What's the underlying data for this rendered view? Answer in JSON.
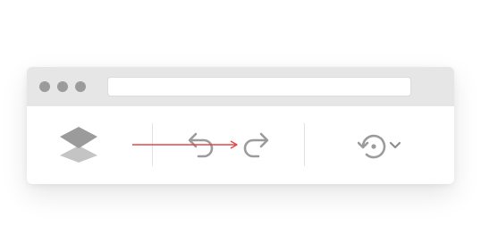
{
  "window": {
    "traffic_lights": [
      "window-dot-1",
      "window-dot-2",
      "window-dot-3"
    ],
    "address_bar": {
      "value": ""
    }
  },
  "toolbar": {
    "icons": [
      "layers-icon",
      "undo-icon",
      "redo-icon",
      "history-icon",
      "chevron-down-icon"
    ]
  },
  "colors": {
    "icon_gray": "#9b9b9b",
    "icon_dark": "#8e8e8e",
    "titlebar": "#e6e6e6",
    "annotation_arrow": "#e04848"
  }
}
